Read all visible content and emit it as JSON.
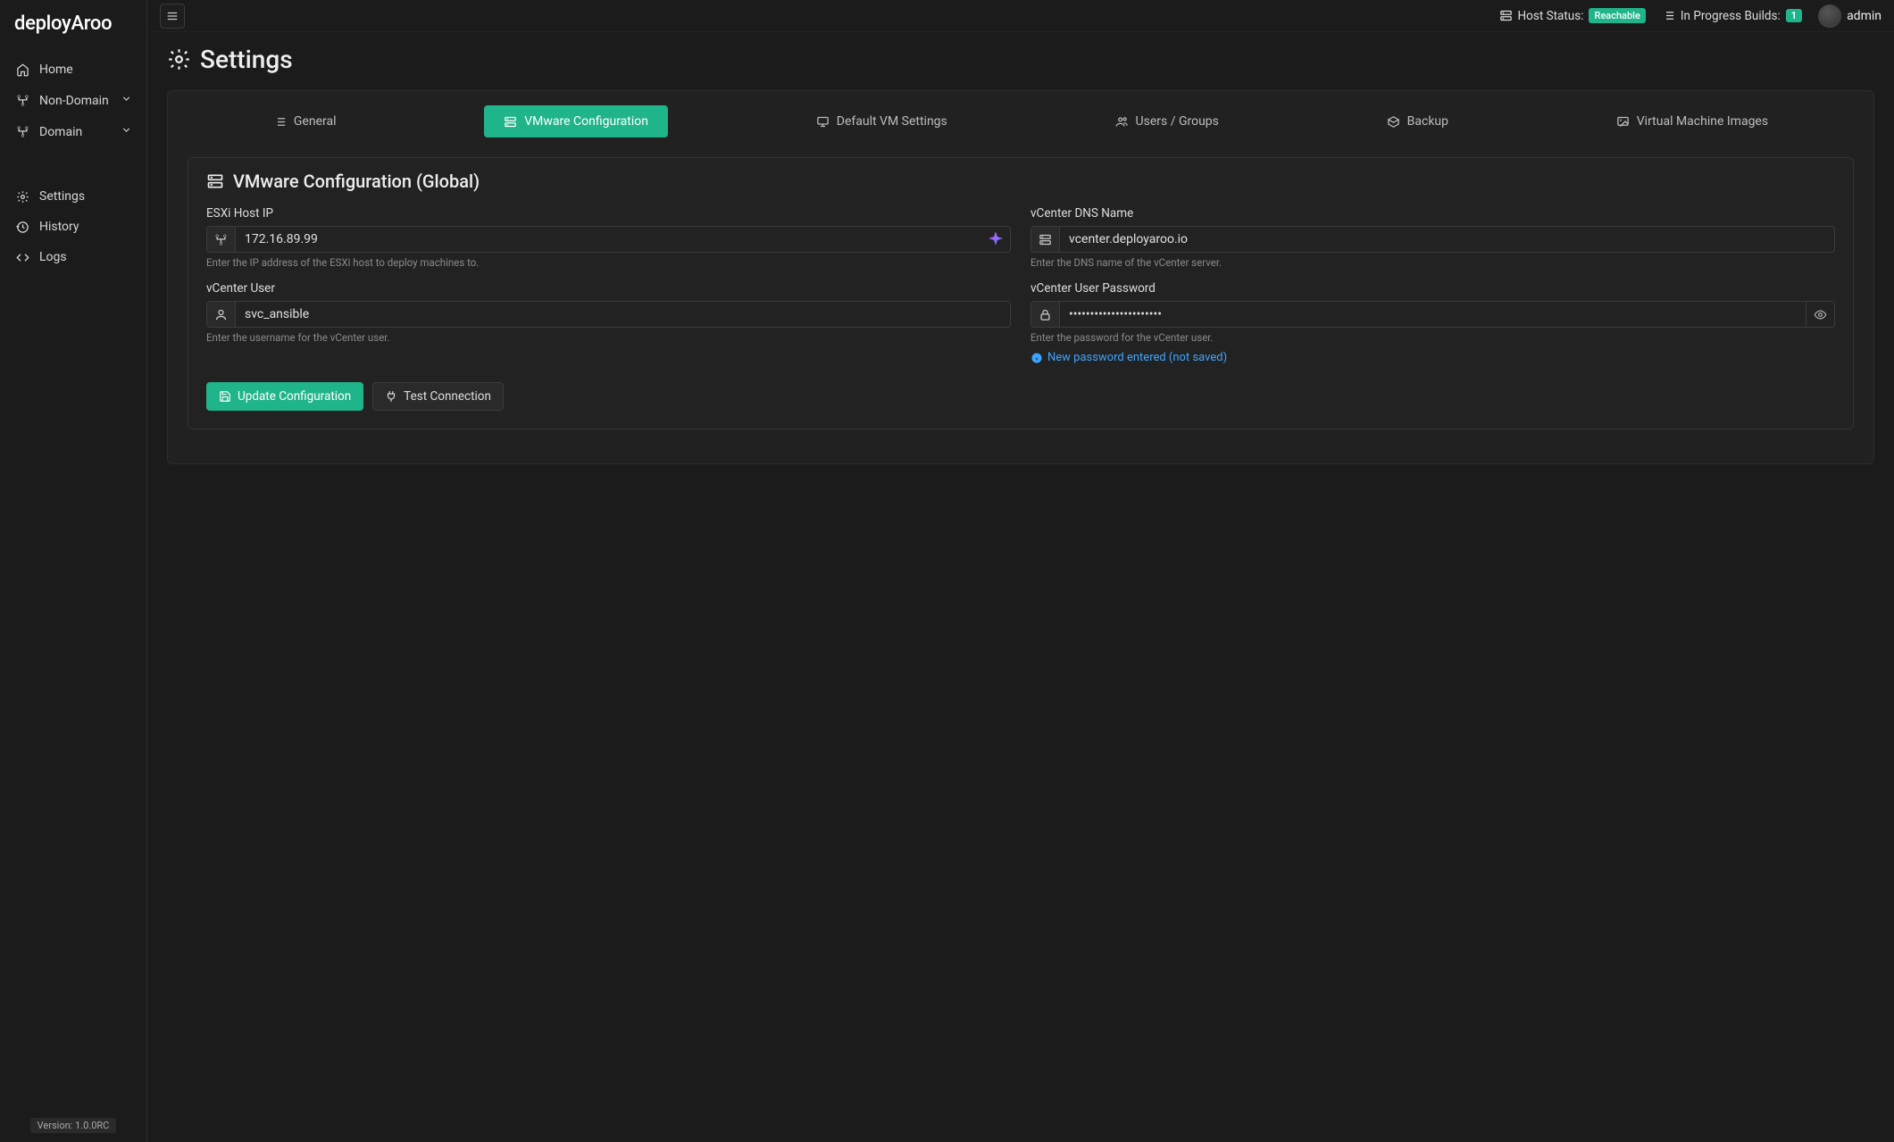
{
  "brand": "deployAroo",
  "sidebar": {
    "items": [
      {
        "label": "Home"
      },
      {
        "label": "Non-Domain"
      },
      {
        "label": "Domain"
      },
      {
        "label": "Settings"
      },
      {
        "label": "History"
      },
      {
        "label": "Logs"
      }
    ],
    "version": "Version: 1.0.0RC"
  },
  "topbar": {
    "host_status_label": "Host Status:",
    "host_status_value": "Reachable",
    "in_progress_label": "In Progress Builds:",
    "in_progress_count": "1",
    "username": "admin"
  },
  "page": {
    "title": "Settings"
  },
  "tabs": [
    {
      "label": "General"
    },
    {
      "label": "VMware Configuration"
    },
    {
      "label": "Default VM Settings"
    },
    {
      "label": "Users / Groups"
    },
    {
      "label": "Backup"
    },
    {
      "label": "Virtual Machine Images"
    }
  ],
  "section": {
    "title": "VMware Configuration (Global)",
    "fields": {
      "esxi_ip": {
        "label": "ESXi Host IP",
        "value": "172.16.89.99",
        "help": "Enter the IP address of the ESXi host to deploy machines to."
      },
      "vcenter_dns": {
        "label": "vCenter DNS Name",
        "value": "vcenter.deployaroo.io",
        "help": "Enter the DNS name of the vCenter server."
      },
      "vcenter_user": {
        "label": "vCenter User",
        "value": "svc_ansible",
        "help": "Enter the username for the vCenter user."
      },
      "vcenter_pw": {
        "label": "vCenter User Password",
        "value": "••••••••••••••••••••••",
        "help": "Enter the password for the vCenter user."
      }
    },
    "info_msg": "New password entered (not saved)",
    "buttons": {
      "update": "Update Configuration",
      "test": "Test Connection"
    }
  }
}
